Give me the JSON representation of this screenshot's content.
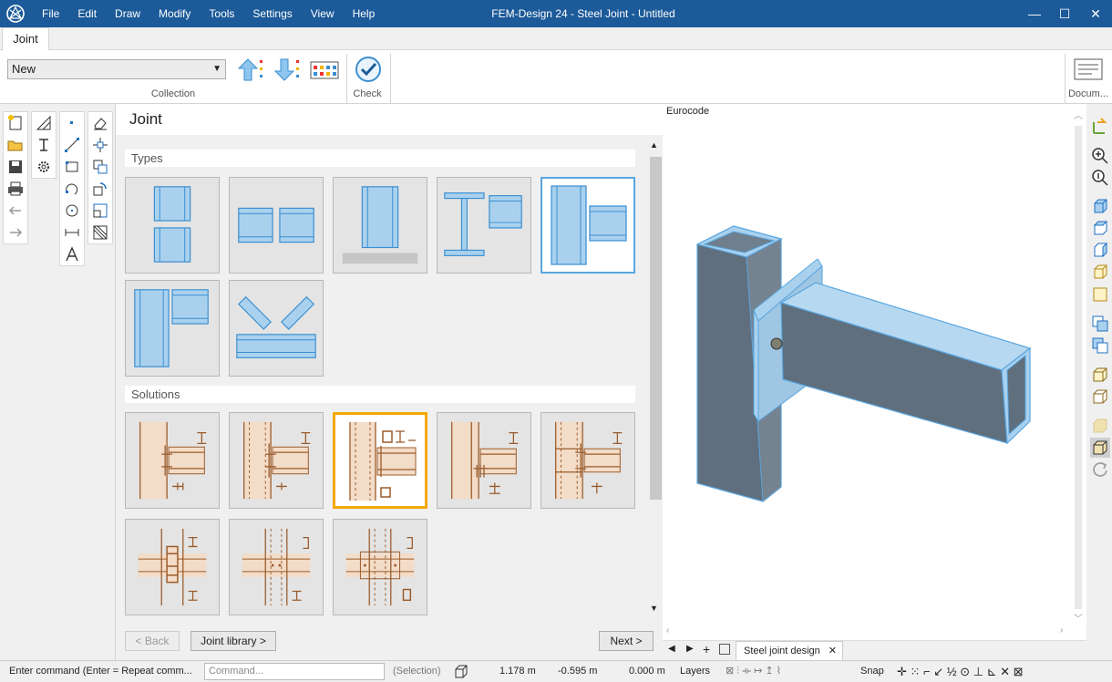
{
  "app": {
    "title": "FEM-Design 24 - Steel Joint - Untitled"
  },
  "menu": [
    "File",
    "Edit",
    "Draw",
    "Modify",
    "Tools",
    "Settings",
    "View",
    "Help"
  ],
  "window_controls": {
    "minimize": "—",
    "maximize": "☐",
    "close": "✕"
  },
  "ribbon": {
    "tab": "Joint",
    "collection_select": "New",
    "collection_label": "Collection",
    "check_label": "Check",
    "document_label": "Docum..."
  },
  "panel": {
    "title": "Joint",
    "types_label": "Types",
    "solutions_label": "Solutions",
    "back_button": "< Back",
    "library_button": "Joint library >",
    "next_button": "Next >"
  },
  "view": {
    "code_label": "Eurocode",
    "tab_label": "Steel joint design",
    "tab_add": "+"
  },
  "statusbar": {
    "prompt": "Enter command (Enter = Repeat comm...",
    "command_placeholder": "Command...",
    "selection": "(Selection)",
    "x": "1.178 m",
    "y": "-0.595 m",
    "z": "0.000 m",
    "layers": "Layers",
    "snap": "Snap"
  },
  "colors": {
    "titlebar": "#1c5a99",
    "selected_type": "#5aa6e0",
    "selected_solution": "#f2a900",
    "member_blue": "#a9d1ee",
    "solution_fill": "#f3dcc8",
    "solution_line": "#9b5b2a"
  }
}
